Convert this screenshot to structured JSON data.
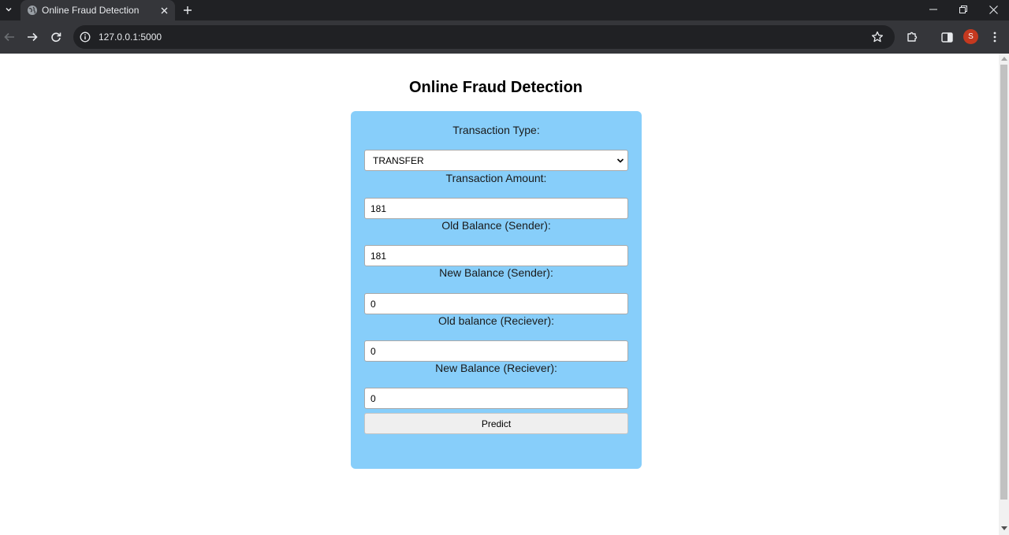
{
  "browser": {
    "tab": {
      "title": "Online Fraud Detection"
    },
    "address": {
      "url": "127.0.0.1:5000"
    },
    "profile_initial": "S"
  },
  "page": {
    "title": "Online Fraud Detection",
    "form": {
      "transaction_type": {
        "label": "Transaction Type:",
        "value": "TRANSFER"
      },
      "amount": {
        "label": "Transaction Amount:",
        "value": "181"
      },
      "old_balance_sender": {
        "label": "Old Balance (Sender):",
        "value": "181"
      },
      "new_balance_sender": {
        "label": "New Balance (Sender):",
        "value": "0"
      },
      "old_balance_receiver": {
        "label": "Old balance (Reciever):",
        "value": "0"
      },
      "new_balance_receiver": {
        "label": "New Balance (Reciever):",
        "value": "0"
      },
      "submit_label": "Predict"
    }
  },
  "colors": {
    "card_background": "#87cefa",
    "tabbar": "#202124",
    "toolbar": "#35363a",
    "avatar": "#c5391f"
  }
}
